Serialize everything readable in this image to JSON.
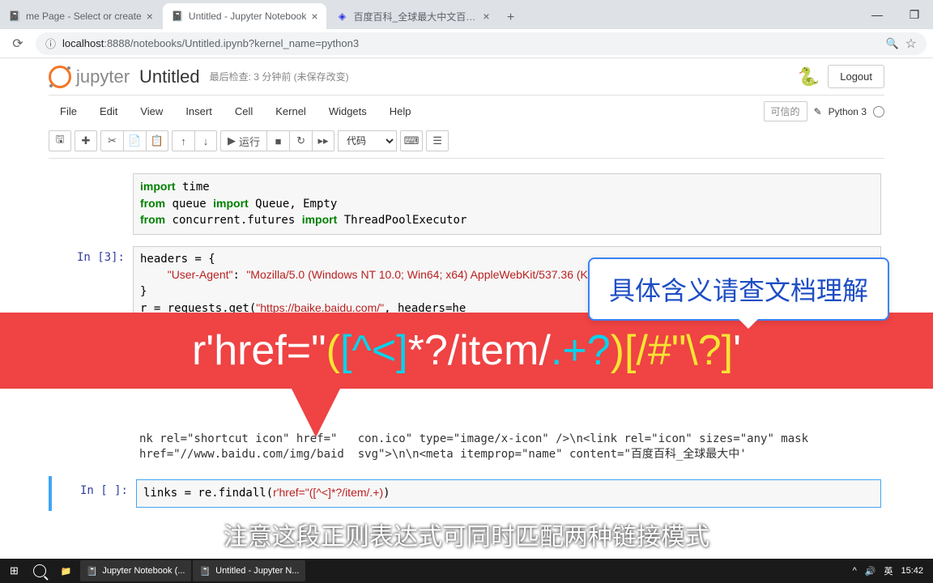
{
  "browser": {
    "tabs": [
      {
        "title": "me Page - Select or create",
        "favicon": "📓"
      },
      {
        "title": "Untitled - Jupyter Notebook",
        "favicon": "📓",
        "active": true
      },
      {
        "title": "百度百科_全球最大中文百科全书",
        "favicon": "🔵"
      }
    ],
    "url_host": "localhost",
    "url_port": ":8888",
    "url_path": "/notebooks/Untitled.ipynb?kernel_name=python3",
    "info_icon": "ⓘ"
  },
  "jupyter": {
    "brand": "jupyter",
    "title": "Untitled",
    "checkpoint": "最后检查: 3 分钟前",
    "saved": "(未保存改变)",
    "logout": "Logout",
    "menus": [
      "File",
      "Edit",
      "View",
      "Insert",
      "Cell",
      "Kernel",
      "Widgets",
      "Help"
    ],
    "trusted": "可信的",
    "kernel": "Python 3",
    "run_label": "运行",
    "cell_type": "代码"
  },
  "cells": {
    "c1": {
      "prompt": "",
      "code": "import time\nfrom queue import Queue, Empty\nfrom concurrent.futures import ThreadPoolExecutor"
    },
    "c2": {
      "prompt": "In [3]:",
      "code": "headers = {\n    \"User-Agent\": \"Mozilla/5.0 (Windows NT 10.0; Win64; x64) AppleWebKit/537.36 (KHTML, like Gecko) Chrome/78.\n}\nr = requests.get(\"https://baike.baidu.com/\", headers=he\nr.encoding = \"utf-8\""
    },
    "c3_out": "nk rel=\"shortcut icon\" href=\"   con.ico\" type=\"image/x-icon\" />\\n<link rel=\"icon\" sizes=\"any\" mask href=\"//www.baidu.com/img/baid  svg\">\\n\\n<meta itemprop=\"name\" content=\"百度百科_全球最大中'",
    "c4": {
      "prompt": "In [ ]:",
      "code": "links = re.findall(r'href=\"([^<]*?/item/.+))"
    }
  },
  "overlay": {
    "regex_pre": "r'href=\"",
    "regex_p1": "(",
    "regex_p2": "[^<]",
    "regex_p3": "*?",
    "regex_p4": "/item/",
    "regex_p5": ".+?",
    "regex_p6": ")",
    "regex_p7": "[/#\"\\?]",
    "regex_suf": "'",
    "callout": "具体含义请查文档理解",
    "subtitle": "注意这段正则表达式可同时匹配两种链接模式"
  },
  "taskbar": {
    "items": [
      "Jupyter Notebook (...",
      "Untitled - Jupyter N..."
    ],
    "ime": "英",
    "time": "15:42"
  }
}
